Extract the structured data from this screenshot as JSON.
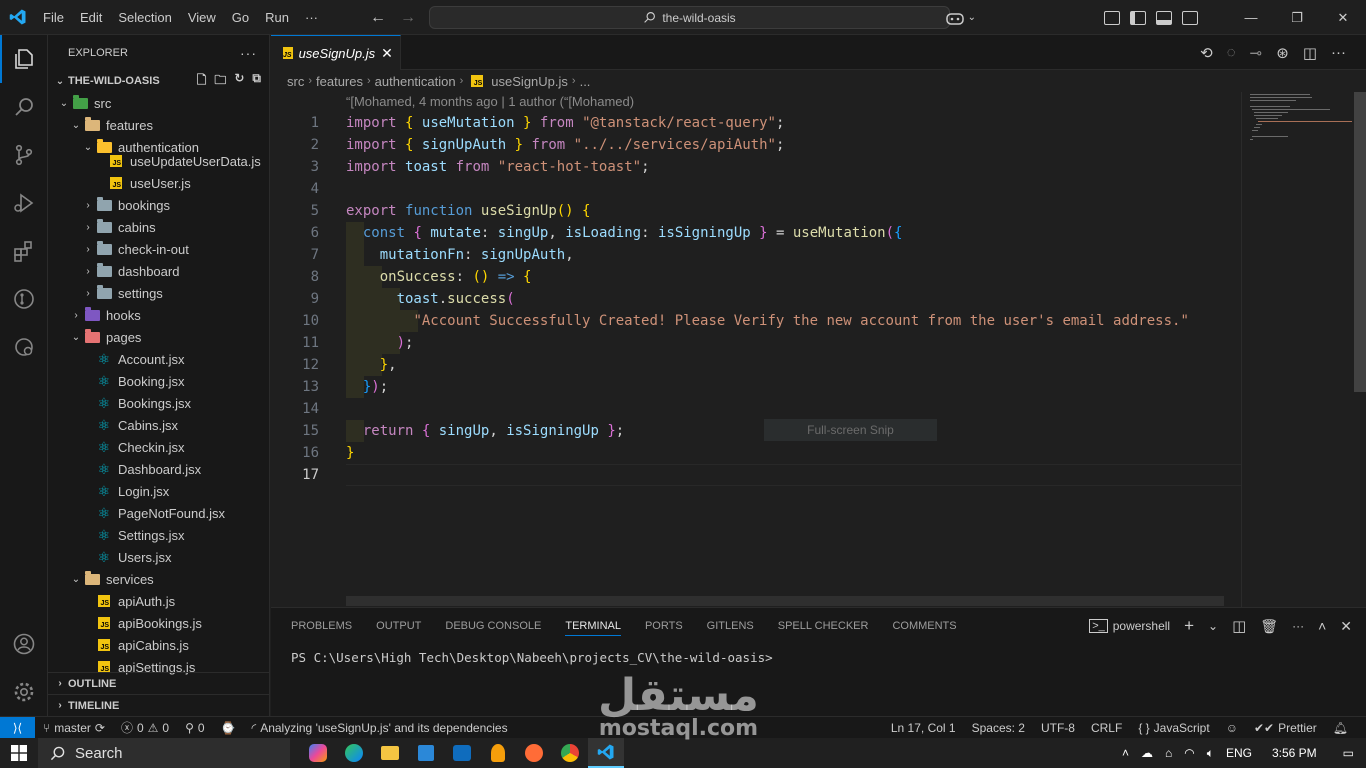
{
  "menu": [
    "File",
    "Edit",
    "Selection",
    "View",
    "Go",
    "Run",
    "···"
  ],
  "command_center": "the-wild-oasis",
  "explorer": {
    "title": "EXPLORER",
    "project": "THE-WILD-OASIS",
    "tree": [
      {
        "label": "src",
        "depth": 1,
        "type": "folder-green",
        "open": true
      },
      {
        "label": "features",
        "depth": 2,
        "type": "folder-open",
        "open": true
      },
      {
        "label": "authentication",
        "depth": 3,
        "type": "folder-yellow",
        "open": true
      },
      {
        "label": "useUpdateUserData.js",
        "depth": 4,
        "type": "js"
      },
      {
        "label": "useUser.js",
        "depth": 4,
        "type": "js"
      },
      {
        "label": "bookings",
        "depth": 3,
        "type": "folder",
        "open": false
      },
      {
        "label": "cabins",
        "depth": 3,
        "type": "folder",
        "open": false
      },
      {
        "label": "check-in-out",
        "depth": 3,
        "type": "folder",
        "open": false
      },
      {
        "label": "dashboard",
        "depth": 3,
        "type": "folder",
        "open": false
      },
      {
        "label": "settings",
        "depth": 3,
        "type": "folder-settings",
        "open": false
      },
      {
        "label": "hooks",
        "depth": 2,
        "type": "folder-purple",
        "open": false
      },
      {
        "label": "pages",
        "depth": 2,
        "type": "folder-red",
        "open": true
      },
      {
        "label": "Account.jsx",
        "depth": 3,
        "type": "react"
      },
      {
        "label": "Booking.jsx",
        "depth": 3,
        "type": "react"
      },
      {
        "label": "Bookings.jsx",
        "depth": 3,
        "type": "react"
      },
      {
        "label": "Cabins.jsx",
        "depth": 3,
        "type": "react"
      },
      {
        "label": "Checkin.jsx",
        "depth": 3,
        "type": "react"
      },
      {
        "label": "Dashboard.jsx",
        "depth": 3,
        "type": "react"
      },
      {
        "label": "Login.jsx",
        "depth": 3,
        "type": "react"
      },
      {
        "label": "PageNotFound.jsx",
        "depth": 3,
        "type": "react"
      },
      {
        "label": "Settings.jsx",
        "depth": 3,
        "type": "react"
      },
      {
        "label": "Users.jsx",
        "depth": 3,
        "type": "react"
      },
      {
        "label": "services",
        "depth": 2,
        "type": "folder-open",
        "open": true
      },
      {
        "label": "apiAuth.js",
        "depth": 3,
        "type": "js"
      },
      {
        "label": "apiBookings.js",
        "depth": 3,
        "type": "js"
      },
      {
        "label": "apiCabins.js",
        "depth": 3,
        "type": "js"
      },
      {
        "label": "apiSettings.js",
        "depth": 3,
        "type": "js"
      }
    ],
    "outline": "OUTLINE",
    "timeline": "TIMELINE"
  },
  "tab": {
    "label": "useSignUp.js",
    "close": "✕"
  },
  "breadcrumb": [
    "src",
    "features",
    "authentication",
    "useSignUp.js",
    "..."
  ],
  "blame": "“[Mohamed, 4 months ago | 1 author (“[Mohamed)",
  "code_lines": [
    "1",
    "2",
    "3",
    "4",
    "5",
    "6",
    "7",
    "8",
    "9",
    "10",
    "11",
    "12",
    "13",
    "14",
    "15",
    "16",
    "17"
  ],
  "code": {
    "l1_a": "import",
    "l1_b": "useMutation",
    "l1_c": "from",
    "l1_d": "\"@tanstack/react-query\"",
    "l2_a": "import",
    "l2_b": "signUpAuth",
    "l2_c": "from",
    "l2_d": "\"../../services/apiAuth\"",
    "l3_a": "import",
    "l3_b": "toast",
    "l3_c": "from",
    "l3_d": "\"react-hot-toast\"",
    "l5_a": "export",
    "l5_b": "function",
    "l5_c": "useSignUp",
    "l6_a": "const",
    "l6_b": "mutate",
    "l6_c": "singUp",
    "l6_d": "isLoading",
    "l6_e": "isSigningUp",
    "l6_f": "useMutation",
    "l7_a": "mutationFn",
    "l7_b": "signUpAuth",
    "l8_a": "onSuccess",
    "l9_a": "toast",
    "l9_b": "success",
    "l10_a": "\"Account Successfully Created! Please Verify the new account from the user's email address.\"",
    "l15_a": "return",
    "l15_b": "singUp",
    "l15_c": "isSigningUp"
  },
  "snip_tooltip": "Full-screen Snip",
  "panel": {
    "tabs": [
      "PROBLEMS",
      "OUTPUT",
      "DEBUG CONSOLE",
      "TERMINAL",
      "PORTS",
      "GITLENS",
      "SPELL CHECKER",
      "COMMENTS"
    ],
    "active_tab": "TERMINAL",
    "shell": "powershell",
    "prompt": "PS C:\\Users\\High Tech\\Desktop\\Nabeeh\\projects_CV\\the-wild-oasis>"
  },
  "status": {
    "branch": "master",
    "errors": "0",
    "warnings": "0",
    "ports": "0",
    "analyzing": "Analyzing 'useSignUp.js' and its dependencies",
    "position": "Ln 17, Col 1",
    "spaces": "Spaces: 2",
    "encoding": "UTF-8",
    "eol": "CRLF",
    "language": "JavaScript",
    "prettier": "Prettier"
  },
  "taskbar": {
    "search": "Search",
    "lang": "ENG",
    "time": "3:56 PM"
  },
  "watermark": {
    "arabic": "مستقل",
    "latin": "mostaql.com"
  },
  "colors": {
    "accent": "#0078d4",
    "editor_bg": "#1f1f1f",
    "sidebar_bg": "#181818"
  }
}
